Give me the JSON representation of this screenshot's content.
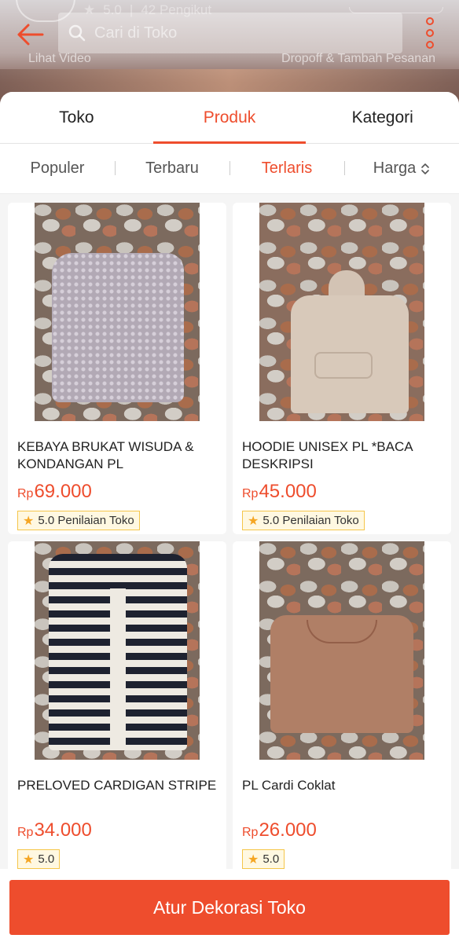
{
  "header": {
    "shop_rating": "5.0",
    "followers_label": "42 Pengikut",
    "search_placeholder": "Cari di Toko",
    "video_label": "Lihat Video",
    "promo_label": "Dropoff & Tambah Pesanan"
  },
  "tabs": [
    {
      "label": "Toko",
      "active": false
    },
    {
      "label": "Produk",
      "active": true
    },
    {
      "label": "Kategori",
      "active": false
    }
  ],
  "sort": [
    {
      "label": "Populer",
      "active": false
    },
    {
      "label": "Terbaru",
      "active": false
    },
    {
      "label": "Terlaris",
      "active": true
    },
    {
      "label": "Harga",
      "active": false
    }
  ],
  "products": [
    {
      "name": "KEBAYA BRUKAT WISUDA & KONDANGAN PL",
      "currency": "Rp",
      "price": "69.000",
      "rating_label": "5.0 Penilaian Toko"
    },
    {
      "name": "HOODIE UNISEX PL *BACA DESKRIPSI",
      "currency": "Rp",
      "price": "45.000",
      "rating_label": "5.0 Penilaian Toko"
    },
    {
      "name": "PRELOVED CARDIGAN STRIPE",
      "currency": "Rp",
      "price": "34.000",
      "rating_label": "5.0"
    },
    {
      "name": "PL Cardi Coklat",
      "currency": "Rp",
      "price": "26.000",
      "rating_label": "5.0"
    }
  ],
  "footer": {
    "button_label": "Atur Dekorasi Toko"
  },
  "colors": {
    "accent": "#ee4d2d",
    "badge_border": "#f5c64a",
    "star": "#f5a623"
  }
}
